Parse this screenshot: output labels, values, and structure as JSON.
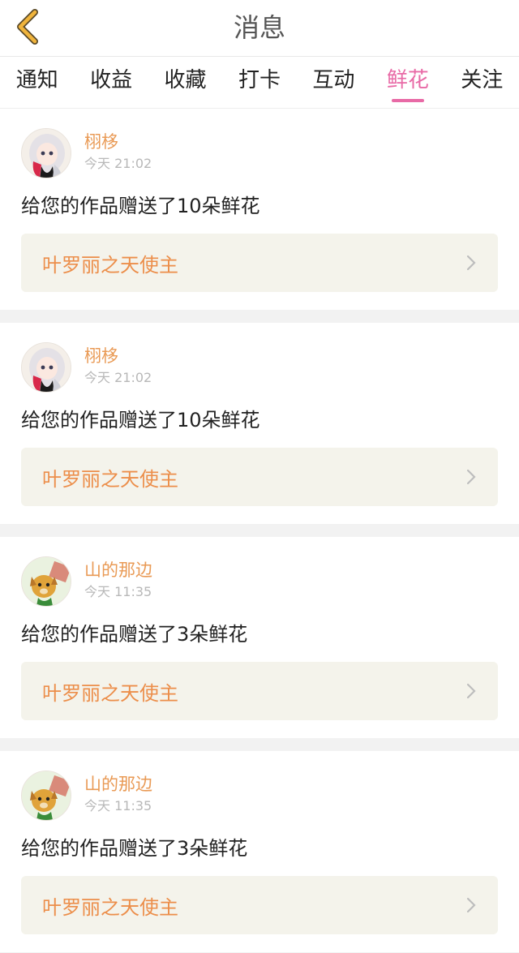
{
  "header": {
    "title": "消息"
  },
  "tabs": [
    {
      "label": "通知"
    },
    {
      "label": "收益"
    },
    {
      "label": "收藏"
    },
    {
      "label": "打卡"
    },
    {
      "label": "互动"
    },
    {
      "label": "鲜花",
      "active": true
    },
    {
      "label": "关注"
    }
  ],
  "messages": [
    {
      "user": "栩栘",
      "time": "今天 21:02",
      "text": "给您的作品赠送了10朵鲜花",
      "work": "叶罗丽之天使主",
      "avatar": "anime-girl-avatar"
    },
    {
      "user": "栩栘",
      "time": "今天 21:02",
      "text": "给您的作品赠送了10朵鲜花",
      "work": "叶罗丽之天使主",
      "avatar": "anime-girl-avatar"
    },
    {
      "user": "山的那边",
      "time": "今天 11:35",
      "text": "给您的作品赠送了3朵鲜花",
      "work": "叶罗丽之天使主",
      "avatar": "cartoon-dog-avatar"
    },
    {
      "user": "山的那边",
      "time": "今天 11:35",
      "text": "给您的作品赠送了3朵鲜花",
      "work": "叶罗丽之天使主",
      "avatar": "cartoon-dog-avatar"
    }
  ],
  "colors": {
    "accent_pink": "#e86aa6",
    "name_orange": "#e99a55",
    "back_yellow": "#f0b43c"
  }
}
